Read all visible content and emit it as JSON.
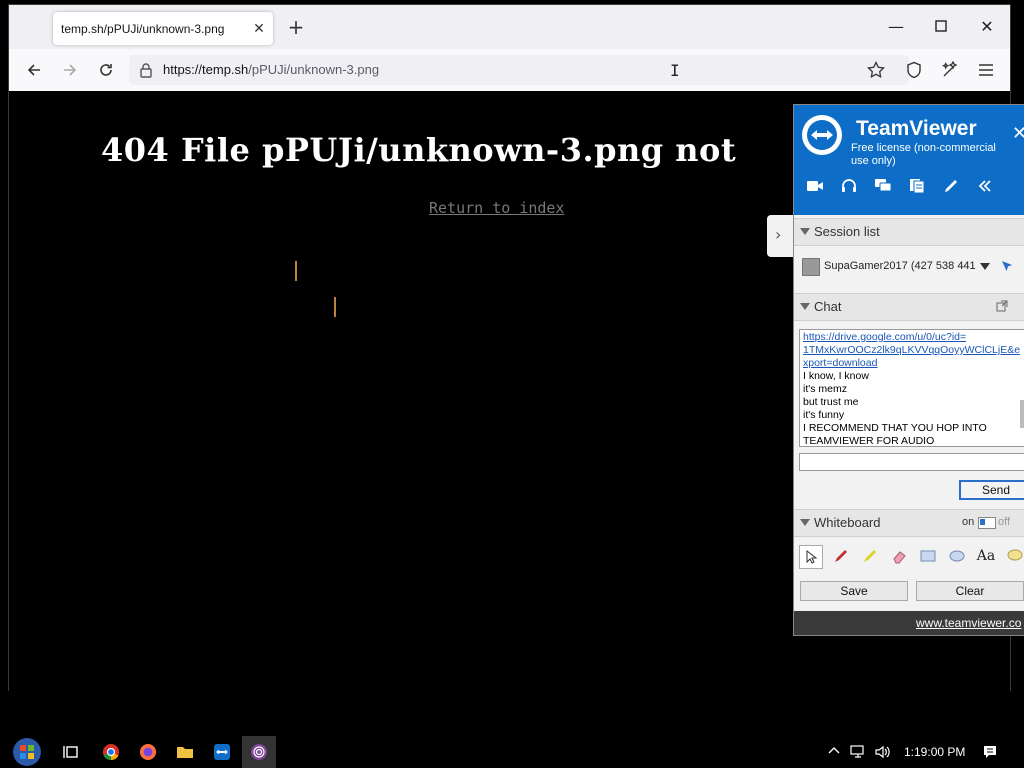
{
  "browser": {
    "tab_title": "temp.sh/pPUJi/unknown-3.png",
    "url_host": "https://temp.sh",
    "url_path": "/pPUJi/unknown-3.png"
  },
  "page": {
    "heading": "404 File pPUJi/unknown-3.png not",
    "return_link": "Return to index"
  },
  "teamviewer": {
    "name": "TeamViewer",
    "license": "Free license (non-commercial use only)",
    "sections": {
      "session_list": "Session list",
      "chat": "Chat",
      "whiteboard": "Whiteboard"
    },
    "session_entry": "SupaGamer2017 (427 538 441",
    "chat_messages": [
      "https://drive.google.com/u/0/uc?id=",
      "1TMxKwrOOCz2lk9qLKVVqqOoyyWClCLjE&e",
      "xport=download",
      "I know, I know",
      "it's memz",
      "but trust me",
      "it's funny",
      "I RECOMMEND THAT YOU HOP INTO",
      "TEAMVIEWER FOR AUDIO"
    ],
    "send_label": "Send",
    "wb_on": "on",
    "wb_off": "off",
    "save_label": "Save",
    "clear_label": "Clear",
    "footer_link": "www.teamviewer.co"
  },
  "taskbar": {
    "clock": "1:19:00 PM"
  },
  "colors": {
    "tv_blue": "#0e6ec7",
    "link_blue": "#1a56b8"
  }
}
